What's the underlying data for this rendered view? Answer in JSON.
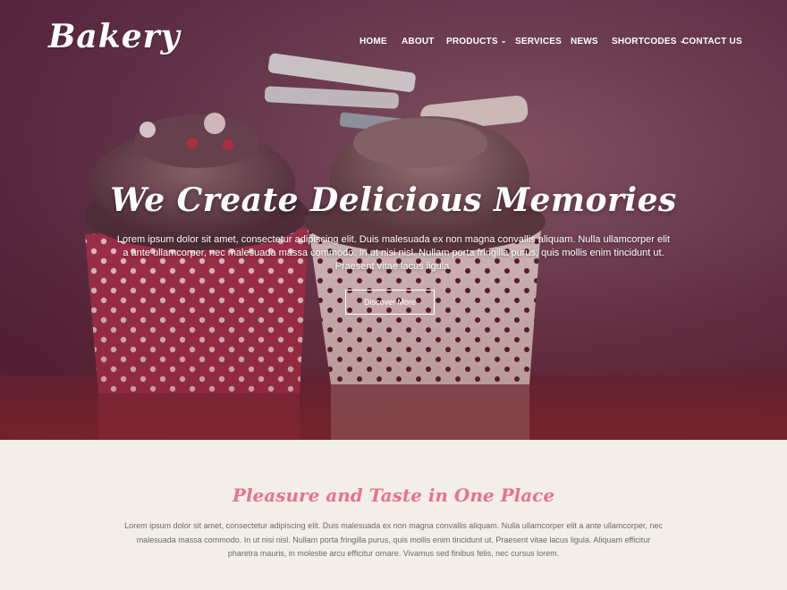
{
  "brand": {
    "logo_text": "Bakery"
  },
  "nav": {
    "items": [
      {
        "label": "HOME",
        "has_dropdown": false
      },
      {
        "label": "ABOUT",
        "has_dropdown": false
      },
      {
        "label": "PRODUCTS",
        "has_dropdown": true
      },
      {
        "label": "SERVICES",
        "has_dropdown": false
      },
      {
        "label": "NEWS",
        "has_dropdown": false
      },
      {
        "label": "SHORTCODES",
        "has_dropdown": true
      },
      {
        "label": "CONTACT US",
        "has_dropdown": false
      }
    ]
  },
  "hero": {
    "title": "We Create Delicious Memories",
    "text": "Lorem ipsum dolor sit amet, consectetur adipiscing elit. Duis malesuada ex non magna convallis aliquam. Nulla ullamcorper elit a ante ullamcorper, nec malesuada massa commodo. In ut nisi nisl. Nullam porta fringilla purus, quis mollis enim tincidunt ut. Praesent vitae lacus ligula.",
    "button_label": "Discover More"
  },
  "intro": {
    "title": "Pleasure and Taste in One Place",
    "text": "Lorem ipsum dolor sit amet, consectetur adipiscing elit. Duis malesuada ex non magna convallis aliquam. Nulla ullamcorper elit a ante ullamcorper, nec malesuada massa commodo. In ut nisi nisl. Nullam porta fringilla purus, quis mollis enim tincidunt ut. Praesent vitae lacus ligula. Aliquam efficitur pharetra mauris, in molestie arcu efficitur ornare. Vivamus sed finibus felis, nec cursus lorem."
  },
  "colors": {
    "accent": "#e8728c",
    "hero_bg": "#6e3f52",
    "section_bg": "#f3efe8",
    "body_text": "#6a6a6a"
  },
  "icons": {
    "dropdown": "chevron-down-icon"
  }
}
